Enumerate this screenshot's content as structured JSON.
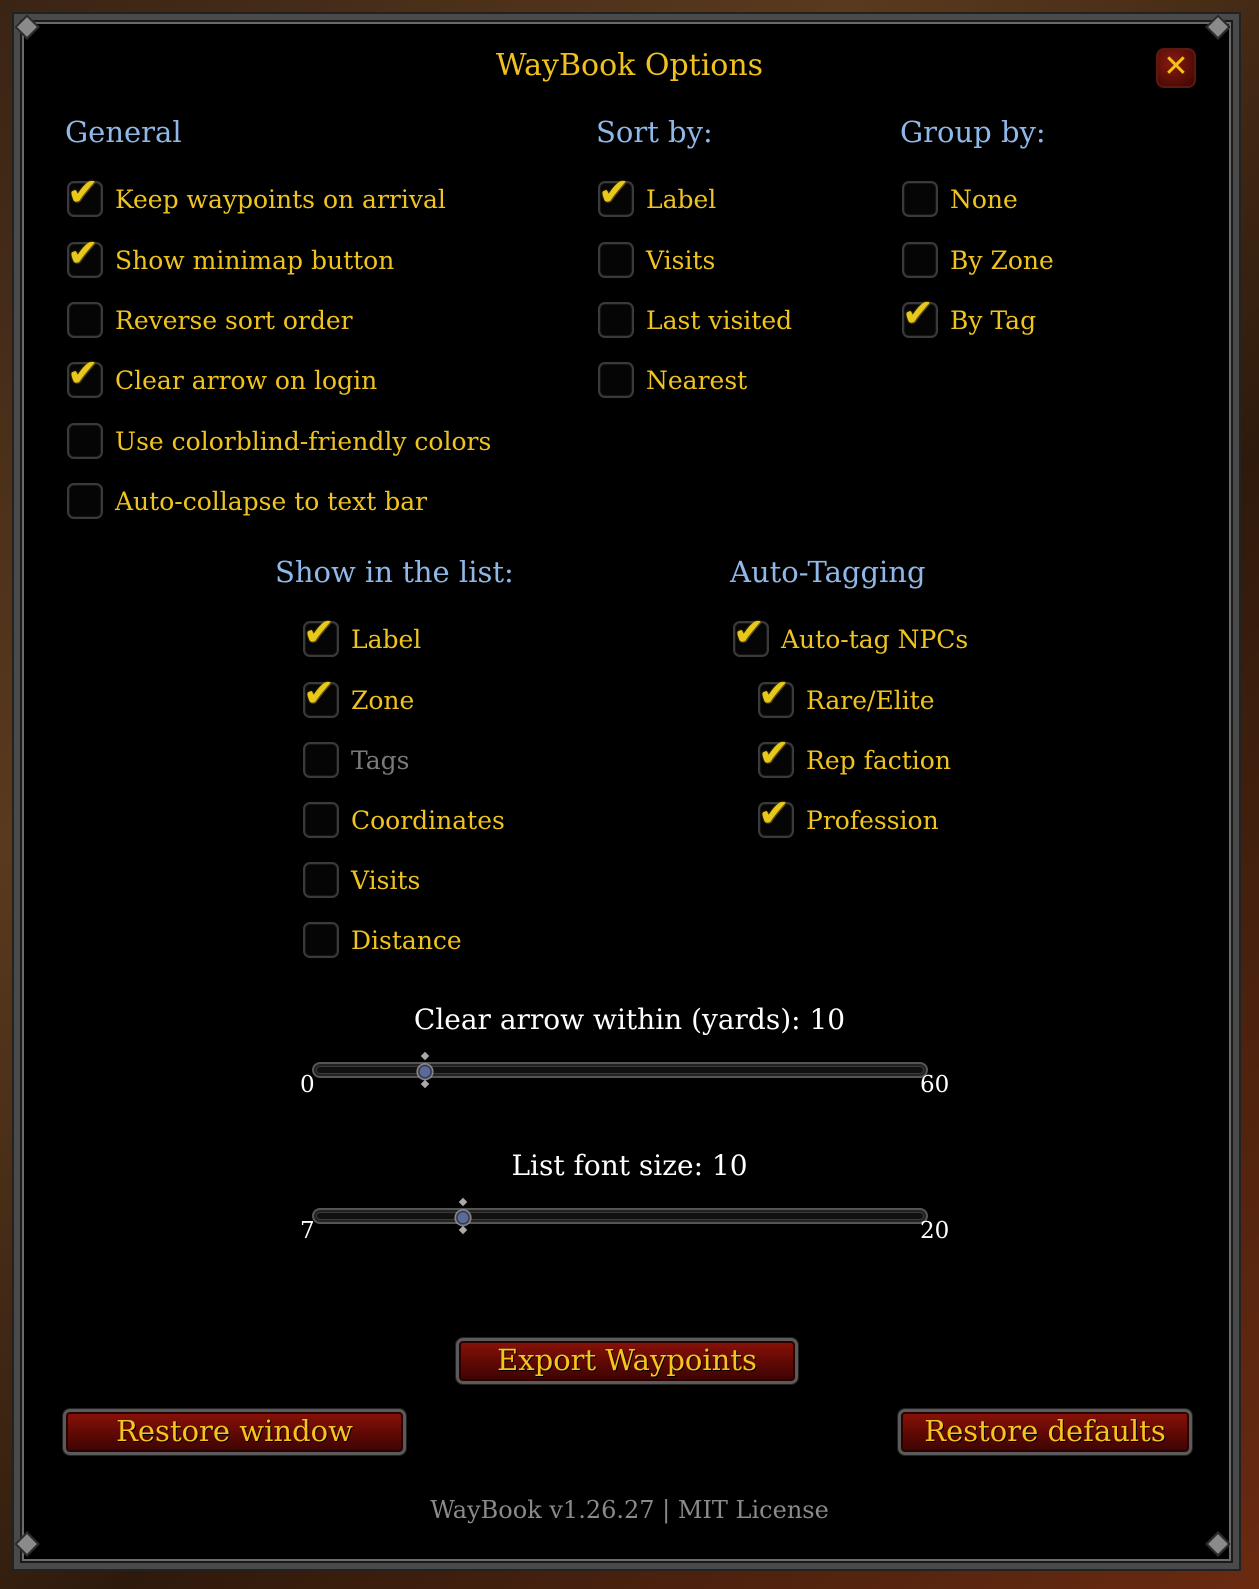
{
  "window": {
    "title": "WayBook Options",
    "close_glyph": "✕"
  },
  "general": {
    "header": "General",
    "items": [
      {
        "label": "Keep waypoints on arrival",
        "checked": true
      },
      {
        "label": "Show minimap button",
        "checked": true
      },
      {
        "label": "Reverse sort order",
        "checked": false
      },
      {
        "label": "Clear arrow on login",
        "checked": true
      },
      {
        "label": "Use colorblind-friendly colors",
        "checked": false
      },
      {
        "label": "Auto-collapse to text bar",
        "checked": false
      }
    ]
  },
  "sort_by": {
    "header": "Sort by:",
    "items": [
      {
        "label": "Label",
        "checked": true
      },
      {
        "label": "Visits",
        "checked": false
      },
      {
        "label": "Last visited",
        "checked": false
      },
      {
        "label": "Nearest",
        "checked": false
      }
    ]
  },
  "group_by": {
    "header": "Group by:",
    "items": [
      {
        "label": "None",
        "checked": false
      },
      {
        "label": "By Zone",
        "checked": false
      },
      {
        "label": "By Tag",
        "checked": true
      }
    ]
  },
  "show_in_list": {
    "header": "Show in the list:",
    "items": [
      {
        "label": "Label",
        "checked": true,
        "disabled": false
      },
      {
        "label": "Zone",
        "checked": true,
        "disabled": false
      },
      {
        "label": "Tags",
        "checked": false,
        "disabled": true
      },
      {
        "label": "Coordinates",
        "checked": false,
        "disabled": false
      },
      {
        "label": "Visits",
        "checked": false,
        "disabled": false
      },
      {
        "label": "Distance",
        "checked": false,
        "disabled": false
      }
    ]
  },
  "auto_tagging": {
    "header": "Auto-Tagging",
    "items": [
      {
        "label": "Auto-tag NPCs",
        "checked": true
      },
      {
        "label": "Rare/Elite",
        "checked": true
      },
      {
        "label": "Rep faction",
        "checked": true
      },
      {
        "label": "Profession",
        "checked": true
      }
    ]
  },
  "sliders": {
    "clear_arrow": {
      "title": "Clear arrow within (yards): 10",
      "min": "0",
      "max": "60",
      "value": 10,
      "min_val": 0,
      "max_val": 60
    },
    "font_size": {
      "title": "List font size: 10",
      "min": "7",
      "max": "20",
      "value": 10,
      "min_val": 7,
      "max_val": 20
    }
  },
  "buttons": {
    "export": "Export Waypoints",
    "restore_window": "Restore window",
    "restore_defaults": "Restore defaults"
  },
  "footer": "WayBook v1.26.27  |  MIT License",
  "colors": {
    "label": "#f0c420",
    "header": "#8fb8e8",
    "check": "#e8c81a"
  }
}
